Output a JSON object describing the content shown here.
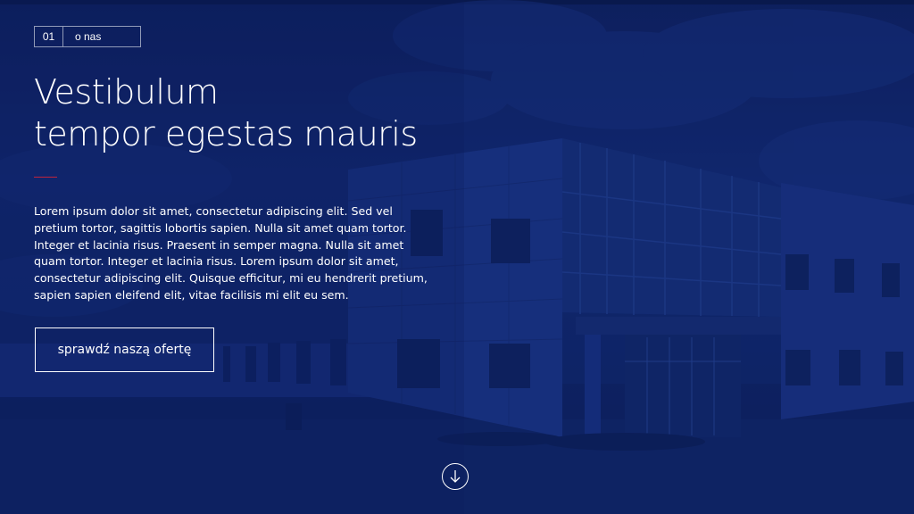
{
  "section": {
    "number": "01",
    "label": "o nas"
  },
  "hero": {
    "title_line1": "Vestibulum",
    "title_line2": "tempor egestas mauris",
    "body": "Lorem ipsum dolor sit amet, consectetur adipiscing elit. Sed vel pretium tortor, sagittis lobortis sapien. Nulla sit amet quam tortor. Integer et lacinia risus. Praesent in semper magna. Nulla sit amet quam tortor. Integer et lacinia risus. Lorem ipsum dolor sit amet, consectetur adipiscing elit. Quisque efficitur, mi eu hendrerit pretium, sapien sapien eleifend elit, vitae facilisis mi elit eu sem.",
    "cta_label": "sprawdź naszą ofertę"
  },
  "icons": {
    "scroll": "arrow-down-circle-icon"
  },
  "colors": {
    "overlay": "#132c78",
    "accent": "#c0243c",
    "text": "#ffffff"
  }
}
